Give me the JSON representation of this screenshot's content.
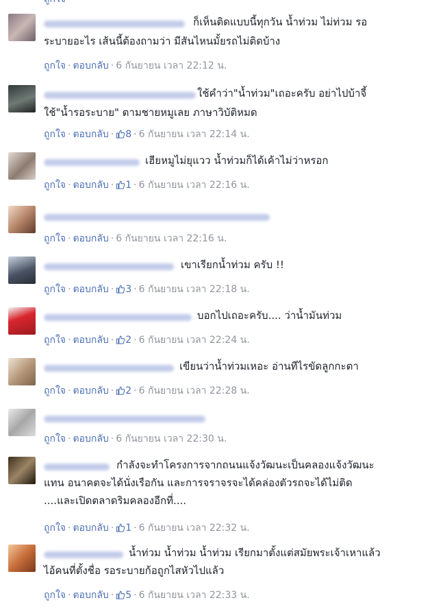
{
  "actions": {
    "like": "ถูกใจ",
    "reply": "ตอบกลับ",
    "sep": "·"
  },
  "comments": [
    {
      "line1": "ก็เห็นติดแบบนี้ทุกวัน น้ำท่วม ไม่ท่วม รอ",
      "line2": "ระบายอะไร เส้นนี้ต้องถามว่า มีสันไหนมั้ยรถไม่ติดบ้าง",
      "likes": "",
      "time": "6 กันยายน เวลา 22:12 น."
    },
    {
      "line1": "ใช้คำว่า\"น้ำท่วม\"เถอะครับ อย่าไปบ้าจี้",
      "line2": "ใช้\"น้ำรอระบาย\" ตามชายหมูเลย ภาษาวิบัติหมด",
      "likes": "8",
      "time": "6 กันยายน เวลา 22:14 น."
    },
    {
      "line1": "เฮียหมูไม่ยุแวว น้ำท่วมก็ได้เค้าไม่ว่าหรอก",
      "line2": "",
      "likes": "1",
      "time": "6 กันยายน เวลา 22:16 น."
    },
    {
      "line1": "",
      "line2": "",
      "likes": "",
      "time": "6 กันยายน เวลา 22:16 น."
    },
    {
      "line1": "เขาเรียกน้ำท่วม ครับ !!",
      "line2": "",
      "likes": "3",
      "time": "6 กันยายน เวลา 22:18 น."
    },
    {
      "line1": "บอกไปเถอะครับ.... ว่าน้ำมันท่วม",
      "line2": "",
      "likes": "2",
      "time": "6 กันยายน เวลา 22:24 น."
    },
    {
      "line1": "เขียนว่าน้ำท่วมเหอะ อ่านทีไรขัดลูกกะตา",
      "line2": "",
      "likes": "2",
      "time": "6 กันยายน เวลา 22:28 น."
    },
    {
      "line1": "",
      "line2": "",
      "likes": "",
      "time": "6 กันยายน เวลา 22:30 น."
    },
    {
      "line1": "กำลังจะทำโครงการจากถนนแจ้งวัฒนะเป็นคลองแจ้งวัฒนะ",
      "line2": "แทน อนาคตจะได้นั่งเรือกัน และการจราจรจะได้คล่องตัวรถจะได้ไม่ติด",
      "line3": "....และเปิดตลาดริมคลองอีกที่....",
      "likes": "1",
      "time": "6 กันยายน เวลา 22:32 น."
    },
    {
      "line1": "น้ำท่วม น้ำท่วม น้ำท่วม เรียกมาตั้งแต่สมัยพระเจ้าเหาแล้ว",
      "line2": "ไอ้คนที่ตั้งชื่อ รอระบายก้อถูกไสหัวไปแล้ว",
      "likes": "5",
      "time": "6 กันยายน เวลา 22:33 น."
    }
  ]
}
